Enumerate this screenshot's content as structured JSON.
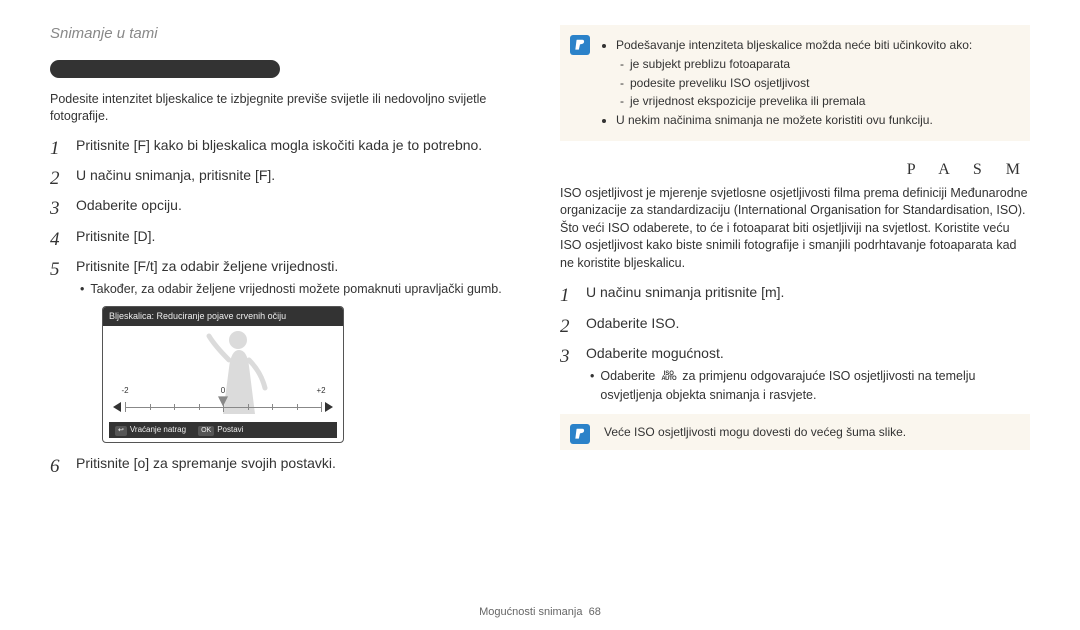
{
  "header": "Snimanje u tami",
  "left": {
    "intro": "Podesite intenzitet bljeskalice te izbjegnite previše svijetle ili nedovoljno svijetle fotografije.",
    "steps": [
      "Pritisnite [F] kako bi bljeskalica mogla iskočiti kada je to potrebno.",
      "U načinu snimanja, pritisnite [F].",
      "Odaberite opciju.",
      "Pritisnite [D].",
      "Pritisnite [F/t] za odabir željene vrijednosti.",
      "Pritisnite [o] za spremanje svojih postavki."
    ],
    "step5_sub": "Također, za odabir željene vrijednosti možete pomaknuti upravljački gumb.",
    "lcd": {
      "title": "Bljeskalica: Reduciranje pojave crvenih očiju",
      "scale_min": "-2",
      "scale_mid": "0",
      "scale_max": "+2",
      "back_badge": "↩",
      "back": "Vraćanje natrag",
      "ok_badge": "OK",
      "ok": "Postavi"
    }
  },
  "right": {
    "note1_b1": "Podešavanje intenziteta bljeskalice možda neće biti učinkovito ako:",
    "note1_d1": "je subjekt preblizu fotoaparata",
    "note1_d2": "podesite preveliku ISO osjetljivost",
    "note1_d3": "je vrijednost ekspozicije prevelika ili premala",
    "note1_b2": "U nekim načinima snimanja ne možete koristiti ovu funkciju.",
    "modes": "P A S M",
    "para": "ISO osjetljivost je mjerenje svjetlosne osjetljivosti filma prema definiciji Međunarodne organizacije za standardizaciju (International Organisation for Standardisation, ISO). Što veći ISO odaberete, to će i fotoaparat biti osjetljiviji na svjetlost. Koristite veću ISO osjetljivost kako biste snimili fotografije i smanjili podrhtavanje fotoaparata kad ne koristite bljeskalicu.",
    "steps": [
      "U načinu snimanja pritisnite [m].",
      "Odaberite ISO.",
      "Odaberite mogućnost."
    ],
    "step3_sub_pre": "Odaberite ",
    "step3_sub_post": " za primjenu odgovarajuće ISO osjetljivosti na temelju osvjetljenja objekta snimanja i rasvjete.",
    "iso_icon_top": "ISO",
    "iso_icon_bottom": "AUTO",
    "note2": "Veće ISO osjetljivosti mogu dovesti do većeg šuma slike."
  },
  "footer": {
    "section": "Mogućnosti snimanja",
    "page": "68"
  }
}
